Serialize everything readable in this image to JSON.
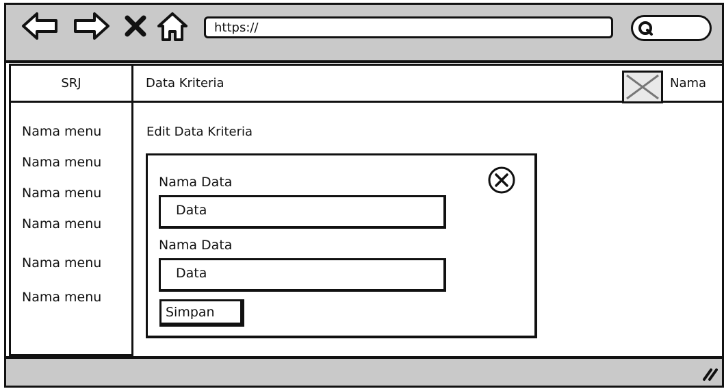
{
  "browser": {
    "url": "https://",
    "icons": [
      "back-icon",
      "forward-icon",
      "close-icon",
      "home-icon",
      "search-icon"
    ]
  },
  "app": {
    "brand": "SRJ",
    "header_title": "Data Kriteria",
    "user_name": "Nama"
  },
  "sidebar": {
    "items": [
      {
        "label": "Nama menu"
      },
      {
        "label": "Nama menu"
      },
      {
        "label": "Nama menu"
      },
      {
        "label": "Nama menu"
      },
      {
        "label": "Nama menu"
      },
      {
        "label": "Nama menu"
      }
    ]
  },
  "main": {
    "page_title": "Edit Data Kriteria",
    "form": {
      "fields": [
        {
          "label": "Nama Data",
          "value": "Data"
        },
        {
          "label": "Nama Data",
          "value": "Data"
        }
      ],
      "submit_label": "Simpan"
    }
  },
  "colors": {
    "bar_gray": "#c9c9c9",
    "ink": "#111111"
  }
}
